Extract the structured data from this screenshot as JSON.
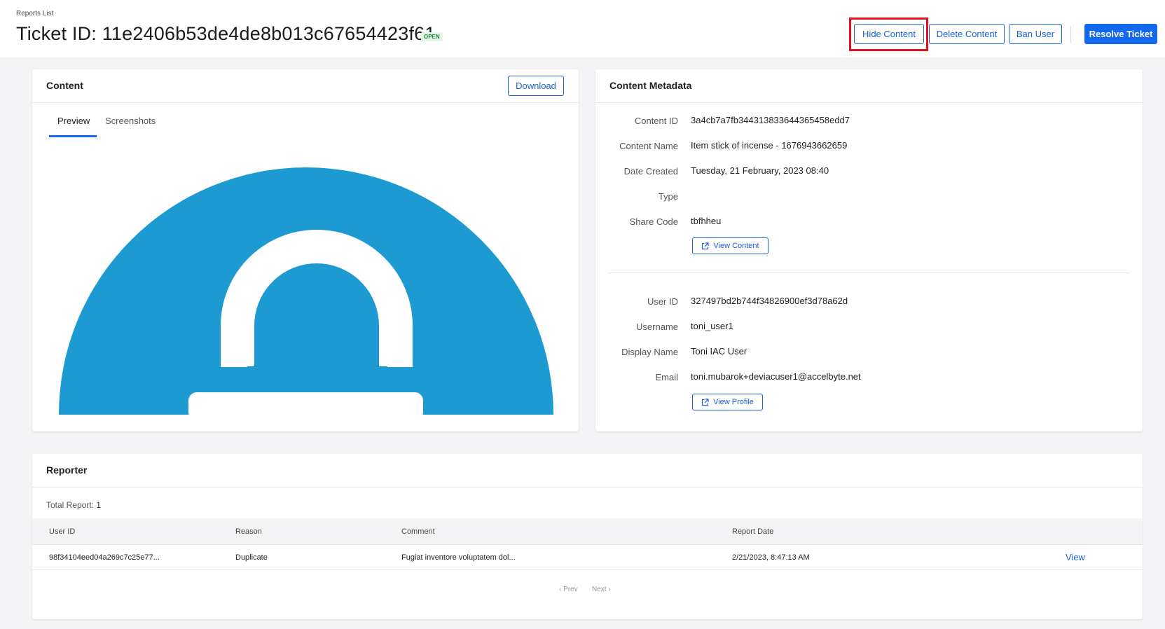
{
  "header": {
    "breadcrumb": "Reports List",
    "ticket_title": "Ticket ID: 11e2406b53de4de8b013c67654423f61",
    "status": "OPEN",
    "buttons": {
      "hide_content": "Hide Content",
      "delete_content": "Delete Content",
      "ban_user": "Ban User",
      "resolve_ticket": "Resolve Ticket"
    }
  },
  "content_card": {
    "title": "Content",
    "download_label": "Download",
    "tabs": [
      {
        "label": "Preview",
        "active": true
      },
      {
        "label": "Screenshots",
        "active": false
      }
    ],
    "preview_icon": "unlocked-padlock-icon",
    "preview_color": "#1e9ad2"
  },
  "metadata_card": {
    "title": "Content Metadata",
    "content_fields": [
      {
        "label": "Content ID",
        "value": "3a4cb7a7fb344313833644365458edd7"
      },
      {
        "label": "Content Name",
        "value": "Item stick of incense - 1676943662659"
      },
      {
        "label": "Date Created",
        "value": "Tuesday, 21 February, 2023 08:40"
      },
      {
        "label": "Type",
        "value": ""
      },
      {
        "label": "Share Code",
        "value": "tbfhheu"
      }
    ],
    "view_content_label": "View Content",
    "user_fields": [
      {
        "label": "User ID",
        "value": "327497bd2b744f34826900ef3d78a62d"
      },
      {
        "label": "Username",
        "value": "toni_user1"
      },
      {
        "label": "Display Name",
        "value": "Toni IAC User"
      },
      {
        "label": "Email",
        "value": "toni.mubarok+deviacuser1@accelbyte.net"
      }
    ],
    "view_profile_label": "View Profile"
  },
  "reporter_card": {
    "title": "Reporter",
    "total_label": "Total Report:",
    "total_value": "1",
    "columns": [
      "User ID",
      "Reason",
      "Comment",
      "Report Date"
    ],
    "rows": [
      {
        "user_id": "98f34104eed04a269c7c25e77...",
        "reason": "Duplicate",
        "comment": "Fugiat inventore voluptatem dol...",
        "report_date": "2/21/2023, 8:47:13 AM",
        "action": "View"
      }
    ],
    "prev_label": "‹ Prev",
    "next_label": "Next ›"
  },
  "colors": {
    "accent": "#1268ee",
    "highlight": "#e0121f",
    "badge_green": "#1e8a3c"
  }
}
